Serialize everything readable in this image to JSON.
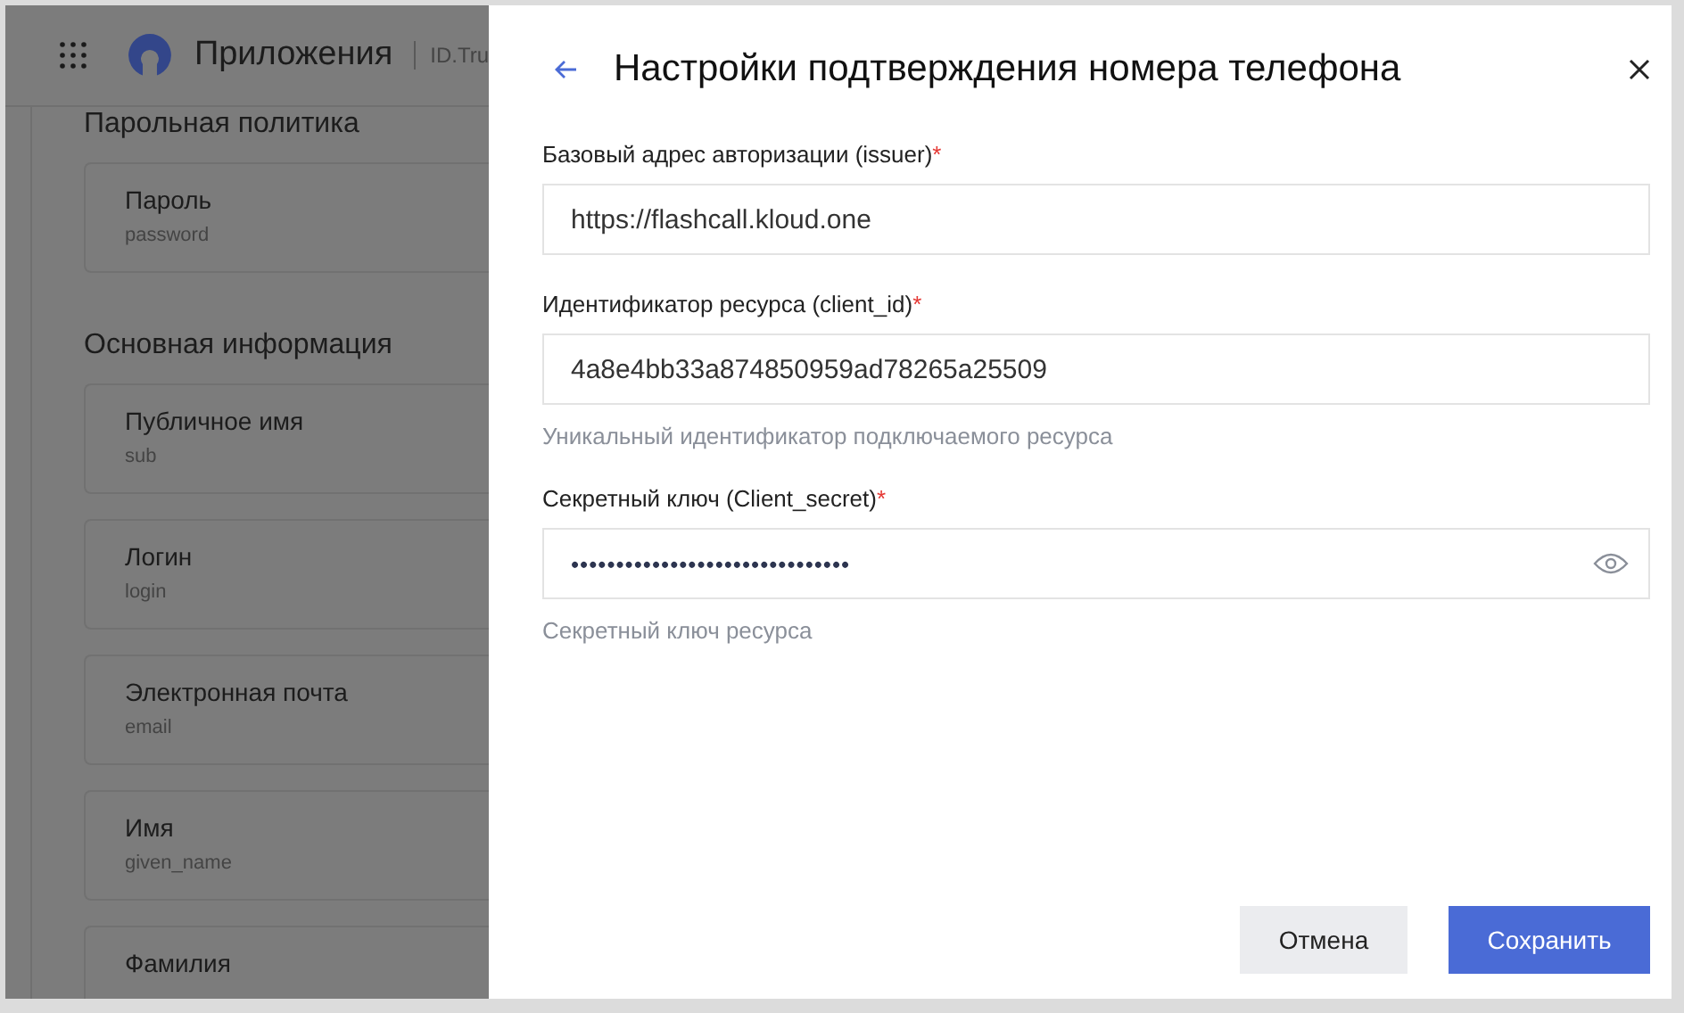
{
  "app_header": {
    "title": "Приложения",
    "subtitle": "ID.Tru"
  },
  "background_page": {
    "sections": [
      {
        "heading": "Парольная политика",
        "cards": [
          {
            "label": "Пароль",
            "key": "password"
          }
        ]
      },
      {
        "heading": "Основная информация",
        "cards": [
          {
            "label": "Публичное имя",
            "key": "sub"
          },
          {
            "label": "Логин",
            "key": "login"
          },
          {
            "label": "Электронная почта",
            "key": "email"
          },
          {
            "label": "Имя",
            "key": "given_name"
          },
          {
            "label": "Фамилия"
          }
        ]
      }
    ]
  },
  "drawer": {
    "title": "Настройки подтверждения номера телефона",
    "fields": [
      {
        "kind": "text",
        "label": "Базовый адрес авторизации (issuer)",
        "required_mark": "*",
        "value": "https://flashcall.kloud.one"
      },
      {
        "kind": "text",
        "label": "Идентификатор ресурса (client_id)",
        "required_mark": "*",
        "value": "4a8e4bb33a874850959ad78265a25509",
        "hint": "Уникальный идентификатор подключаемого ресурса"
      },
      {
        "kind": "password",
        "label": "Секретный ключ (Client_secret)",
        "required_mark": "*",
        "value": "•••••••••••••••••••••••••••••••",
        "hint": "Секретный ключ ресурса"
      }
    ],
    "buttons": [
      {
        "label": "Отмена",
        "kind": "secondary"
      },
      {
        "label": "Сохранить",
        "kind": "primary"
      }
    ]
  }
}
